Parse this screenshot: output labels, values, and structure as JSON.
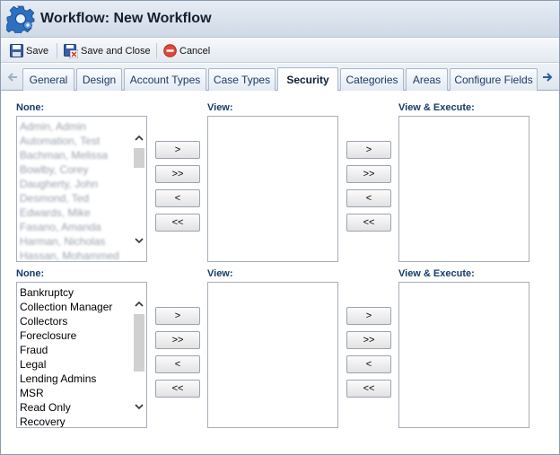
{
  "window": {
    "title": "Workflow: New Workflow"
  },
  "toolbar": {
    "save_label": "Save",
    "save_close_label": "Save and Close",
    "cancel_label": "Cancel"
  },
  "tabs": [
    {
      "label": "General"
    },
    {
      "label": "Design"
    },
    {
      "label": "Account Types"
    },
    {
      "label": "Case Types"
    },
    {
      "label": "Security",
      "active": true
    },
    {
      "label": "Categories"
    },
    {
      "label": "Areas"
    },
    {
      "label": "Configure Fields"
    }
  ],
  "users_section": {
    "none_label": "None:",
    "view_label": "View:",
    "view_execute_label": "View & Execute:",
    "none_items": [
      "Admin, Admin",
      "Automation, Test",
      "Bachman, Melissa",
      "Bowlby, Corey",
      "Daugherty, John",
      "Desmond, Ted",
      "Edwards, Mike",
      "Fasano, Amanda",
      "Harman, Nicholas",
      "Hassan, Mohammed"
    ],
    "view_items": [],
    "view_execute_items": []
  },
  "groups_section": {
    "none_label": "None:",
    "view_label": "View:",
    "view_execute_label": "View & Execute:",
    "none_items": [
      "Bankruptcy",
      "Collection Manager",
      "Collectors",
      "Foreclosure",
      "Fraud",
      "Legal",
      "Lending Admins",
      "MSR",
      "Read Only",
      "Recovery"
    ],
    "view_items": [],
    "view_execute_items": []
  },
  "move_buttons": {
    "add": ">",
    "add_all": ">>",
    "remove": "<",
    "remove_all": "<<"
  },
  "colors": {
    "label": "#173a6b",
    "tab_text": "#1a3a66",
    "titlebar": "#d6dfea"
  }
}
